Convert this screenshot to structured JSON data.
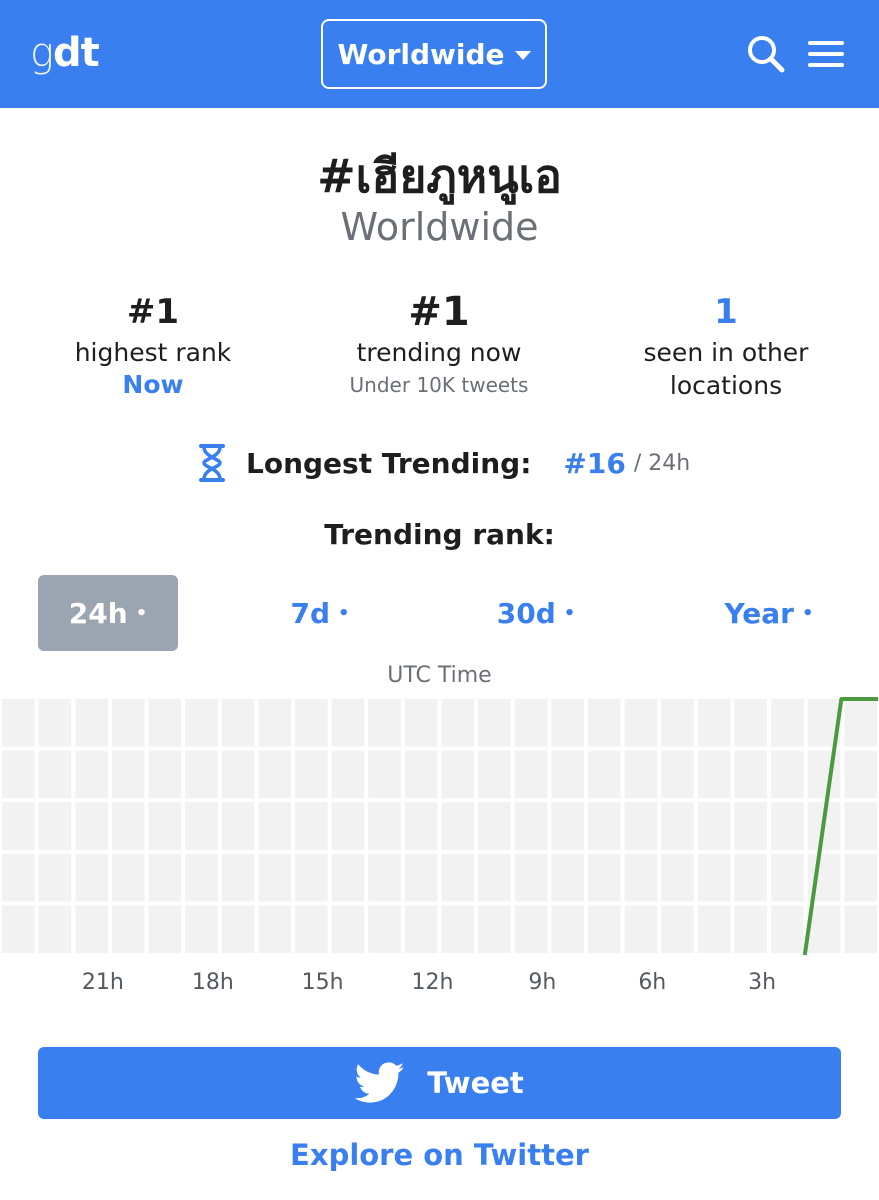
{
  "header": {
    "logo_g": "g",
    "logo_dt": "dt",
    "location_label": "Worldwide",
    "search_icon": "search-icon",
    "menu_icon": "menu-icon"
  },
  "trend": {
    "hashtag": "#เฮียภูหนูเอ",
    "location": "Worldwide"
  },
  "stats": {
    "highest_rank": {
      "value": "#1",
      "label": "highest rank",
      "when": "Now"
    },
    "trending_now": {
      "value": "#1",
      "label": "trending now",
      "tweets": "Under 10K tweets"
    },
    "other_locations": {
      "value": "1",
      "label_line1": "seen in other",
      "label_line2": "locations"
    }
  },
  "longest_trending": {
    "icon": "hourglass-icon",
    "label": "Longest Trending:",
    "rank": "#16",
    "range": "/ 24h"
  },
  "rank_heading": "Trending rank:",
  "tabs": [
    {
      "label": "24h",
      "dot": "•",
      "active": true
    },
    {
      "label": "7d",
      "dot": "•",
      "active": false
    },
    {
      "label": "30d",
      "dot": "•",
      "active": false
    },
    {
      "label": "Year",
      "dot": "•",
      "active": false
    }
  ],
  "chart_data": {
    "type": "line",
    "xlabel": "UTC Time",
    "x_ticks": [
      "21h",
      "18h",
      "15h",
      "12h",
      "9h",
      "6h",
      "3h"
    ],
    "series": [
      {
        "color": "#4a9a3f",
        "points": [
          {
            "hours_ago": 2.0,
            "rank": 50
          },
          {
            "hours_ago": 1.0,
            "rank": 1
          },
          {
            "hours_ago": 0.0,
            "rank": 1
          }
        ]
      }
    ],
    "y_inverted": true,
    "grid": true
  },
  "actions": {
    "tweet_label": "Tweet",
    "explore_label": "Explore on Twitter"
  },
  "colors": {
    "brand_blue": "#3a7ff0",
    "active_tab": "#9aa5b1",
    "line_green": "#4a9a3f"
  }
}
